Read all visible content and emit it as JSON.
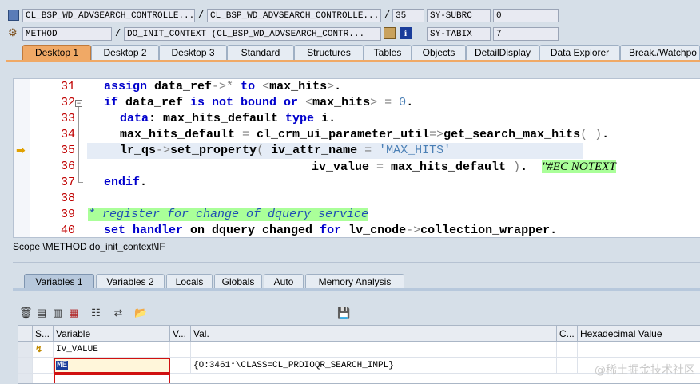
{
  "header": {
    "row1": {
      "program": "CL_BSP_WD_ADVSEARCH_CONTROLLE...",
      "include": "CL_BSP_WD_ADVSEARCH_CONTROLLE...",
      "line": "35",
      "sysvar_name": "SY-SUBRC",
      "sysvar_value": "0"
    },
    "row2": {
      "event_type": "METHOD",
      "event": "DO_INIT_CONTEXT (CL_BSP_WD_ADVSEARCH_CONTR...",
      "sysvar_name": "SY-TABIX",
      "sysvar_value": "7"
    }
  },
  "desktop_tabs": [
    "Desktop 1",
    "Desktop 2",
    "Desktop 3",
    "Standard",
    "Structures",
    "Tables",
    "Objects",
    "DetailDisplay",
    "Data Explorer",
    "Break./Watchpo"
  ],
  "editor": {
    "line_numbers": [
      "31",
      "32",
      "33",
      "34",
      "35",
      "36",
      "37",
      "38",
      "39",
      "40"
    ],
    "current_line": "35",
    "lines": [
      {
        "pre": "assign data_ref->* ",
        "kw": "to",
        "post": " <max_hits>."
      },
      {
        "pre": "if data_ref ",
        "kw": "is not bound or",
        "post": " <max_hits> = 0."
      },
      {
        "pre": "  data: max_hits_default ",
        "kw": "type",
        "post": " i."
      },
      {
        "pre": "  max_hits_default = cl_crm_ui_parameter_util=>get_search_max_hits( ).",
        "kw": "",
        "post": ""
      },
      {
        "pre": "  lr_qs->set_property( iv_attr_name = ",
        "kw": "",
        "post": "'MAX_HITS'"
      },
      {
        "pre": "                        iv_value = max_hits_default ).  ",
        "kw": "",
        "post": "\"#EC NOTEXT"
      },
      {
        "pre": "endif.",
        "kw": "",
        "post": ""
      },
      {
        "pre": "",
        "kw": "",
        "post": ""
      },
      {
        "pre": "* register for change of dquery service",
        "kw": "",
        "post": ""
      },
      {
        "pre": "set handler on dquery changed for lv_cnode->collection_wrapper.",
        "kw": "",
        "post": ""
      }
    ]
  },
  "scope": "Scope \\METHOD do_init_context\\IF",
  "variable_tabs": [
    "Variables 1",
    "Variables 2",
    "Locals",
    "Globals",
    "Auto",
    "Memory Analysis"
  ],
  "grid": {
    "headers": [
      "S...",
      "Variable",
      "V...",
      "Val.",
      "C...",
      "Hexadecimal Value"
    ],
    "rows": [
      {
        "variable": "IV_VALUE",
        "value": ""
      },
      {
        "variable": "ME",
        "value": "{O:3461*\\CLASS=CL_PRDIOQR_SEARCH_IMPL}"
      }
    ]
  },
  "watermark": "@稀土掘金技术社区"
}
